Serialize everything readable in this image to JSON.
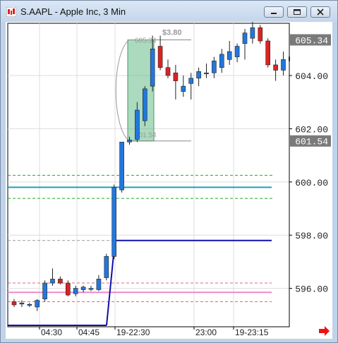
{
  "window": {
    "title": "S.AAPL - Apple Inc, 3 Min",
    "buttons": [
      "minimize-button",
      "maximize-button",
      "close-button"
    ]
  },
  "chart_data": {
    "type": "candlestick",
    "ylim": [
      594.85,
      607.1
    ],
    "y_ticks": [
      "604.00",
      "602.00",
      "600.00",
      "598.00",
      "596.00"
    ],
    "x_tick_labels": [
      "04:30",
      "04:45",
      "19-22:30",
      "23:00",
      "19-23:15"
    ],
    "price_badges": [
      {
        "label": "605.34",
        "value": 605.34
      },
      {
        "label": "601.54",
        "value": 601.54
      }
    ],
    "measure": {
      "label": "$3.80",
      "top_label": "605.34",
      "bottom_label": "601.54",
      "top": 605.34,
      "bottom": 601.54
    },
    "levels": [
      {
        "value": 600.25,
        "color": "#22aa22",
        "style": "dashed"
      },
      {
        "value": 599.8,
        "color": "#1aa3b8",
        "style": "solid"
      },
      {
        "value": 599.38,
        "color": "#22aa22",
        "style": "dashed"
      },
      {
        "value": 597.8,
        "color": "#1010aa",
        "style": "solid"
      },
      {
        "value": 597.8,
        "color": "#999999",
        "style": "dashed"
      },
      {
        "value": 596.2,
        "color": "#dd6688",
        "style": "dashed"
      },
      {
        "value": 595.85,
        "color": "#ee88cc",
        "style": "solid"
      },
      {
        "value": 595.5,
        "color": "#dd6688",
        "style": "dashed"
      }
    ],
    "candles": [
      {
        "o": 595.5,
        "h": 595.6,
        "l": 595.3,
        "c": 595.38
      },
      {
        "o": 595.45,
        "h": 595.55,
        "l": 595.3,
        "c": 595.45
      },
      {
        "o": 595.38,
        "h": 595.45,
        "l": 595.3,
        "c": 595.4
      },
      {
        "o": 595.3,
        "h": 595.6,
        "l": 595.15,
        "c": 595.55
      },
      {
        "o": 595.6,
        "h": 596.3,
        "l": 595.5,
        "c": 596.2
      },
      {
        "o": 596.2,
        "h": 596.75,
        "l": 596.1,
        "c": 596.35
      },
      {
        "o": 596.35,
        "h": 596.45,
        "l": 596.15,
        "c": 596.2
      },
      {
        "o": 596.2,
        "h": 596.3,
        "l": 595.7,
        "c": 595.75
      },
      {
        "o": 595.8,
        "h": 596.1,
        "l": 595.7,
        "c": 596.0
      },
      {
        "o": 595.95,
        "h": 596.1,
        "l": 595.85,
        "c": 596.05
      },
      {
        "o": 596.0,
        "h": 596.1,
        "l": 595.9,
        "c": 596.0
      },
      {
        "o": 595.95,
        "h": 596.5,
        "l": 595.9,
        "c": 596.35
      },
      {
        "o": 596.4,
        "h": 597.3,
        "l": 596.3,
        "c": 597.2
      },
      {
        "o": 597.2,
        "h": 599.9,
        "l": 597.1,
        "c": 599.8
      },
      {
        "o": 599.7,
        "h": 600.55,
        "l": 599.6,
        "c": 601.5
      },
      {
        "o": 601.5,
        "h": 601.7,
        "l": 601.4,
        "c": 601.58
      },
      {
        "o": 601.6,
        "h": 603.0,
        "l": 601.5,
        "c": 602.7
      },
      {
        "o": 602.3,
        "h": 603.6,
        "l": 602.1,
        "c": 603.5
      },
      {
        "o": 603.6,
        "h": 605.5,
        "l": 603.4,
        "c": 605.0
      },
      {
        "o": 605.1,
        "h": 605.5,
        "l": 604.2,
        "c": 604.3
      },
      {
        "o": 604.3,
        "h": 604.6,
        "l": 603.9,
        "c": 604.0
      },
      {
        "o": 604.1,
        "h": 604.4,
        "l": 603.1,
        "c": 603.8
      },
      {
        "o": 603.4,
        "h": 604.0,
        "l": 603.2,
        "c": 603.6
      },
      {
        "o": 603.7,
        "h": 604.1,
        "l": 603.1,
        "c": 603.9
      },
      {
        "o": 603.9,
        "h": 604.3,
        "l": 603.6,
        "c": 604.15
      },
      {
        "o": 604.1,
        "h": 604.45,
        "l": 603.9,
        "c": 604.1
      },
      {
        "o": 604.1,
        "h": 604.7,
        "l": 603.9,
        "c": 604.55
      },
      {
        "o": 604.3,
        "h": 605.0,
        "l": 604.1,
        "c": 604.8
      },
      {
        "o": 604.6,
        "h": 605.3,
        "l": 604.4,
        "c": 604.9
      },
      {
        "o": 604.7,
        "h": 605.2,
        "l": 604.5,
        "c": 605.1
      },
      {
        "o": 605.2,
        "h": 605.75,
        "l": 604.6,
        "c": 605.6
      },
      {
        "o": 605.4,
        "h": 606.2,
        "l": 605.2,
        "c": 605.8
      },
      {
        "o": 605.8,
        "h": 605.9,
        "l": 605.2,
        "c": 605.3
      },
      {
        "o": 605.3,
        "h": 605.4,
        "l": 604.3,
        "c": 604.4
      },
      {
        "o": 604.4,
        "h": 604.6,
        "l": 603.8,
        "c": 604.2
      },
      {
        "o": 604.2,
        "h": 604.9,
        "l": 604.0,
        "c": 604.6
      },
      {
        "o": 604.7,
        "h": 604.8,
        "l": 604.4,
        "c": 604.55
      }
    ],
    "colors": {
      "up": "#2277dd",
      "down": "#dd2222",
      "grid": "#dddddd",
      "badge_bg": "#7a7a7a",
      "measure_fill": "#66bb88"
    }
  }
}
